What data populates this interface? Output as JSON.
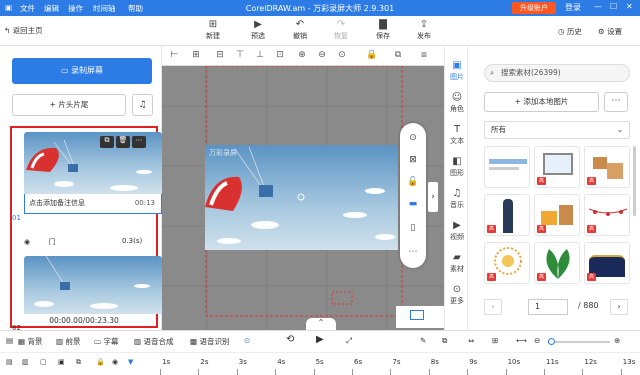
{
  "titlebar": {
    "menus": [
      "文件",
      "编辑",
      "操作",
      "时间轴",
      "帮助"
    ],
    "title": "CorelDRAW.am - 万彩录屏大师 2.9.301",
    "vip_label": "升级账户",
    "login_label": "登录"
  },
  "toolbar": {
    "back_label": "返回主页",
    "new_label": "新建",
    "preview_label": "预选",
    "undo_label": "撤销",
    "redo_label": "恢复",
    "save_label": "保存",
    "publish_label": "发布",
    "history_label": "历史",
    "settings_label": "设置"
  },
  "left": {
    "record_label": "录制屏幕",
    "intro_outro_label": "片头片尾",
    "clips": [
      {
        "index": "01",
        "caption": "点击添加备注信息",
        "duration": "00:13"
      },
      {
        "index": "02"
      }
    ],
    "transition_label": "门",
    "transition_time": "0.3(s)",
    "time_readout": "00:00.00/00:23.30"
  },
  "canvas": {
    "watermark": "万彩录屏",
    "layer_label": "1"
  },
  "side_tabs": [
    "图片",
    "角色",
    "文本",
    "图形",
    "音乐",
    "视频",
    "素材",
    "更多"
  ],
  "assets": {
    "search_placeholder": "搜索素材(26399)",
    "add_local_label": "添加本地图片",
    "filter_value": "所有",
    "page_current": "1",
    "page_total": "/ 880",
    "vip_tag": "高"
  },
  "timeline_toolbar": [
    "背景",
    "前景",
    "字幕",
    "语音合成",
    "语音识别"
  ],
  "ruler": [
    "1s",
    "2s",
    "3s",
    "4s",
    "5s",
    "6s",
    "7s",
    "8s",
    "9s",
    "10s",
    "11s",
    "12s",
    "13s"
  ],
  "colors": {
    "accent": "#2d7be5",
    "highlight": "#e02020",
    "vip": "#ff5722"
  }
}
